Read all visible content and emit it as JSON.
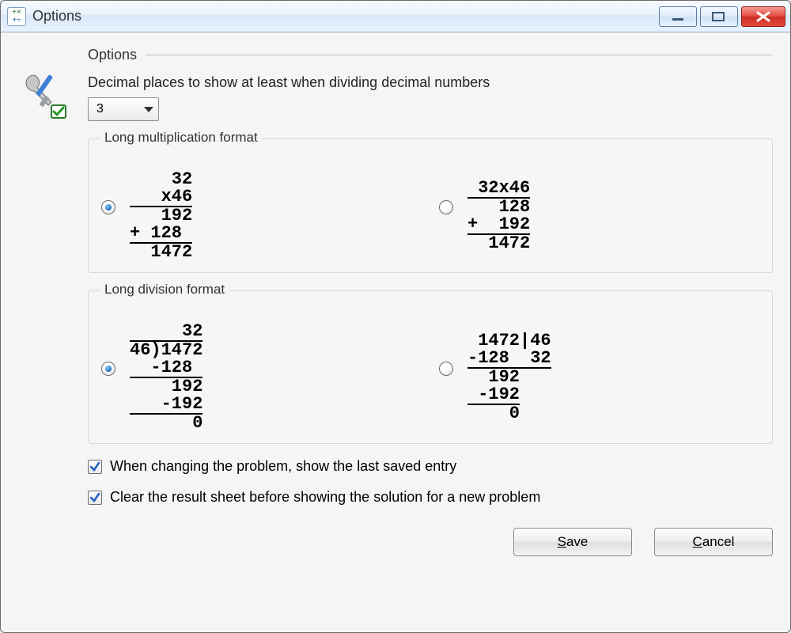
{
  "window": {
    "title": "Options"
  },
  "section_title": "Options",
  "decimal_label": "Decimal places to show at least when dividing decimal numbers",
  "decimal_value": "3",
  "group_mult": {
    "legend": "Long multiplication format",
    "option_a_selected": true,
    "option_b_selected": false,
    "sample_a_lines": [
      "    32",
      "   x46",
      "   192",
      "+ 128 ",
      "  1472"
    ],
    "sample_b_lines": [
      " 32x46",
      "   128",
      "+  192",
      "  1472"
    ]
  },
  "group_div": {
    "legend": "Long division format",
    "option_a_selected": true,
    "option_b_selected": false,
    "sample_a_lines": [
      "     32",
      "46)1472",
      "  -128 ",
      "    192",
      "   -192",
      "      0"
    ],
    "sample_b_lines": [
      " 1472|46",
      "-128  32",
      "  192",
      " -192",
      "    0"
    ]
  },
  "check1": {
    "checked": true,
    "label": "When changing the problem, show the last saved entry"
  },
  "check2": {
    "checked": true,
    "label": "Clear the result sheet before showing the solution for a new problem"
  },
  "buttons": {
    "save_prefix": "",
    "save_u": "S",
    "save_rest": "ave",
    "cancel_prefix": "",
    "cancel_u": "C",
    "cancel_rest": "ancel"
  }
}
